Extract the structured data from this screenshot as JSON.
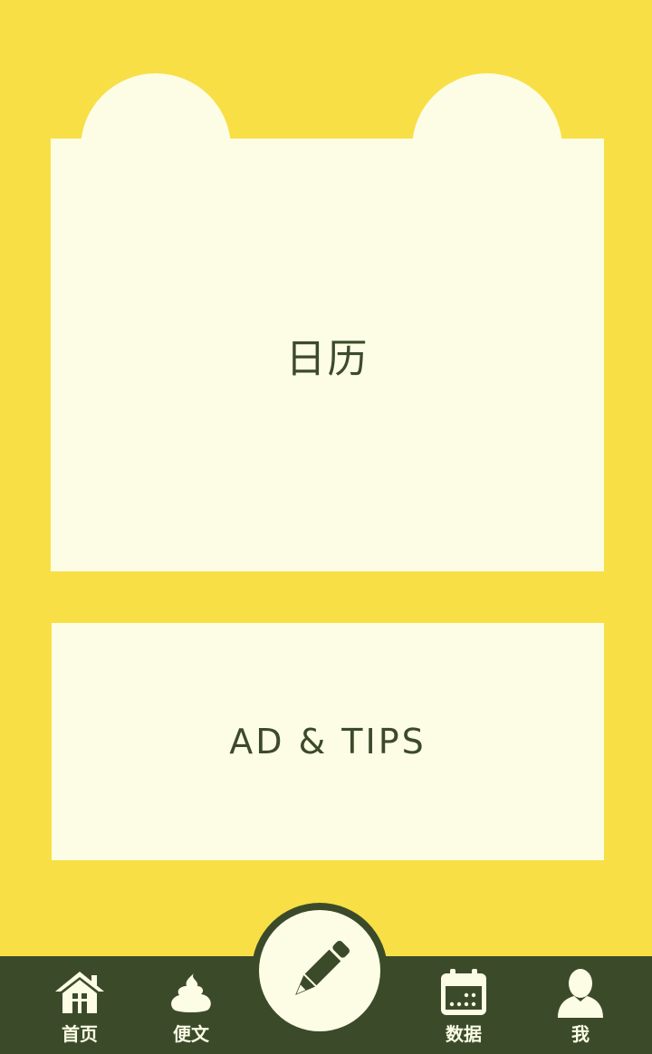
{
  "main": {
    "calendar_label": "日历",
    "ad_label": "AD & TIPS"
  },
  "tabbar": {
    "tabs": [
      {
        "label": "首页",
        "icon": "home-icon"
      },
      {
        "label": "便文",
        "icon": "poop-icon"
      },
      {
        "label": "数据",
        "icon": "calendar-icon"
      },
      {
        "label": "我",
        "icon": "user-icon"
      }
    ],
    "compose_icon": "pencil-icon"
  },
  "colors": {
    "background": "#f8df46",
    "card": "#fdfde6",
    "tabbar": "#3b4b2a",
    "text": "#3c4a2a"
  }
}
